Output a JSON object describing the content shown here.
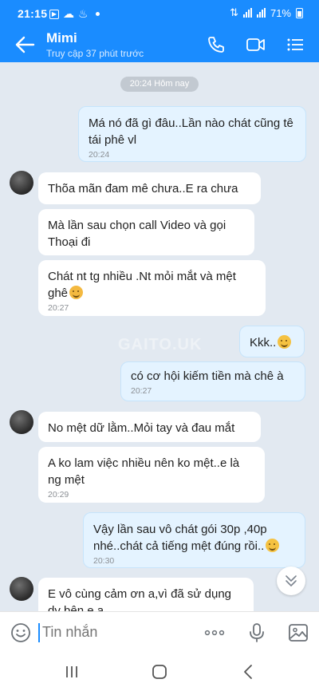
{
  "status_bar": {
    "time": "21:15",
    "battery": "71%"
  },
  "header": {
    "name": "Mimi",
    "last_seen": "Truy cập 37 phút trước"
  },
  "date_separator": "20:24 Hôm nay",
  "watermark": "GAITO.UK",
  "messages": [
    {
      "from": "me",
      "text": "Má nó đã gì đâu..Lần nào chát cũng tê tái phê vl",
      "time": "20:24"
    },
    {
      "from": "them",
      "text": "Thõa mãn đam mê chưa..E ra chưa"
    },
    {
      "from": "them",
      "text": "Mà lần sau chọn call Video và gọi Thoại đi"
    },
    {
      "from": "them",
      "text": "Chát nt tg nhiều .Nt mỏi mắt và mệt ghê",
      "emoji": "weary-face",
      "time": "20:27"
    },
    {
      "from": "me",
      "text": "Kkk..",
      "emoji": "grinning-sweat-face"
    },
    {
      "from": "me",
      "text": "có cơ hội kiếm tiền mà chê à",
      "time": "20:27"
    },
    {
      "from": "them",
      "text": "No mệt dữ lằm..Mỏi tay và đau mắt"
    },
    {
      "from": "them",
      "text": "A ko lam việc nhiều nên ko mệt..e là ng mệt",
      "time": "20:29"
    },
    {
      "from": "me",
      "text": "Vậy lần sau vô chát gói 30p ,40p nhé..chát cả tiếng mệt đúng rồi..",
      "emoji": "grinning-sweat-face",
      "time": "20:30"
    },
    {
      "from": "them",
      "text": "E vô cùng cảm ơn a,vì đã sử dụng dv bên e a"
    }
  ],
  "input": {
    "placeholder": "Tin nhắn"
  },
  "colors": {
    "brand": "#1a8cff",
    "chat_bg": "#e2e9f1",
    "sent_bubble": "#e4f3ff",
    "received_bubble": "#ffffff"
  }
}
